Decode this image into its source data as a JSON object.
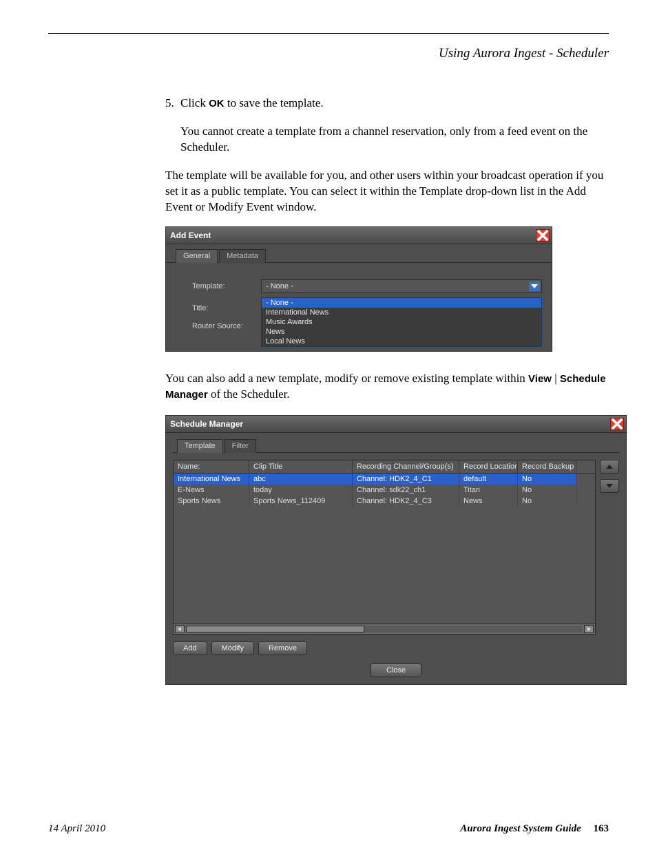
{
  "header": {
    "running_head": "Using Aurora Ingest - Scheduler"
  },
  "body": {
    "step_num": "5.",
    "step_text_pre": "Click ",
    "step_text_bold": "OK",
    "step_text_post": " to save the template.",
    "note": "You cannot create a template from a channel reservation, only from a feed event on the Scheduler.",
    "para1": "The template will be available for you, and other users within your broadcast operation if you set it as a public template. You can select it within the Template drop-down list in the Add Event or Modify Event window.",
    "para2_pre": "You can also add a new template, modify or remove existing template within ",
    "para2_view": "View",
    "para2_pipe": " | ",
    "para2_sm": "Schedule Manager",
    "para2_post": " of the Scheduler."
  },
  "dialog1": {
    "title": "Add Event",
    "tabs": [
      "General",
      "Metadata"
    ],
    "labels": {
      "template": "Template:",
      "title": "Title:",
      "router": "Router Source:"
    },
    "combo_value": "- None -",
    "options": [
      "- None -",
      "International News",
      "Music Awards",
      "News",
      "Local News"
    ]
  },
  "dialog2": {
    "title": "Schedule Manager",
    "tabs": [
      "Template",
      "Filter"
    ],
    "columns": [
      "Name:",
      "Clip Title",
      "Recording Channel/Group(s)",
      "Record Location",
      "Record Backup"
    ],
    "rows": [
      {
        "name": "International News",
        "clip": "abc",
        "chan": "Channel: HDK2_4_C1",
        "loc": "default",
        "bk": "No",
        "selected": true
      },
      {
        "name": "E-News",
        "clip": "today",
        "chan": "Channel: sdk22_ch1",
        "loc": "Titan",
        "bk": "No",
        "selected": false
      },
      {
        "name": "Sports News",
        "clip": "Sports News_112409",
        "chan": "Channel: HDK2_4_C3",
        "loc": "News",
        "bk": "No",
        "selected": false
      }
    ],
    "buttons": {
      "add": "Add",
      "modify": "Modify",
      "remove": "Remove",
      "close": "Close"
    }
  },
  "footer": {
    "date": "14 April 2010",
    "guide": "Aurora Ingest System Guide",
    "page": "163"
  }
}
